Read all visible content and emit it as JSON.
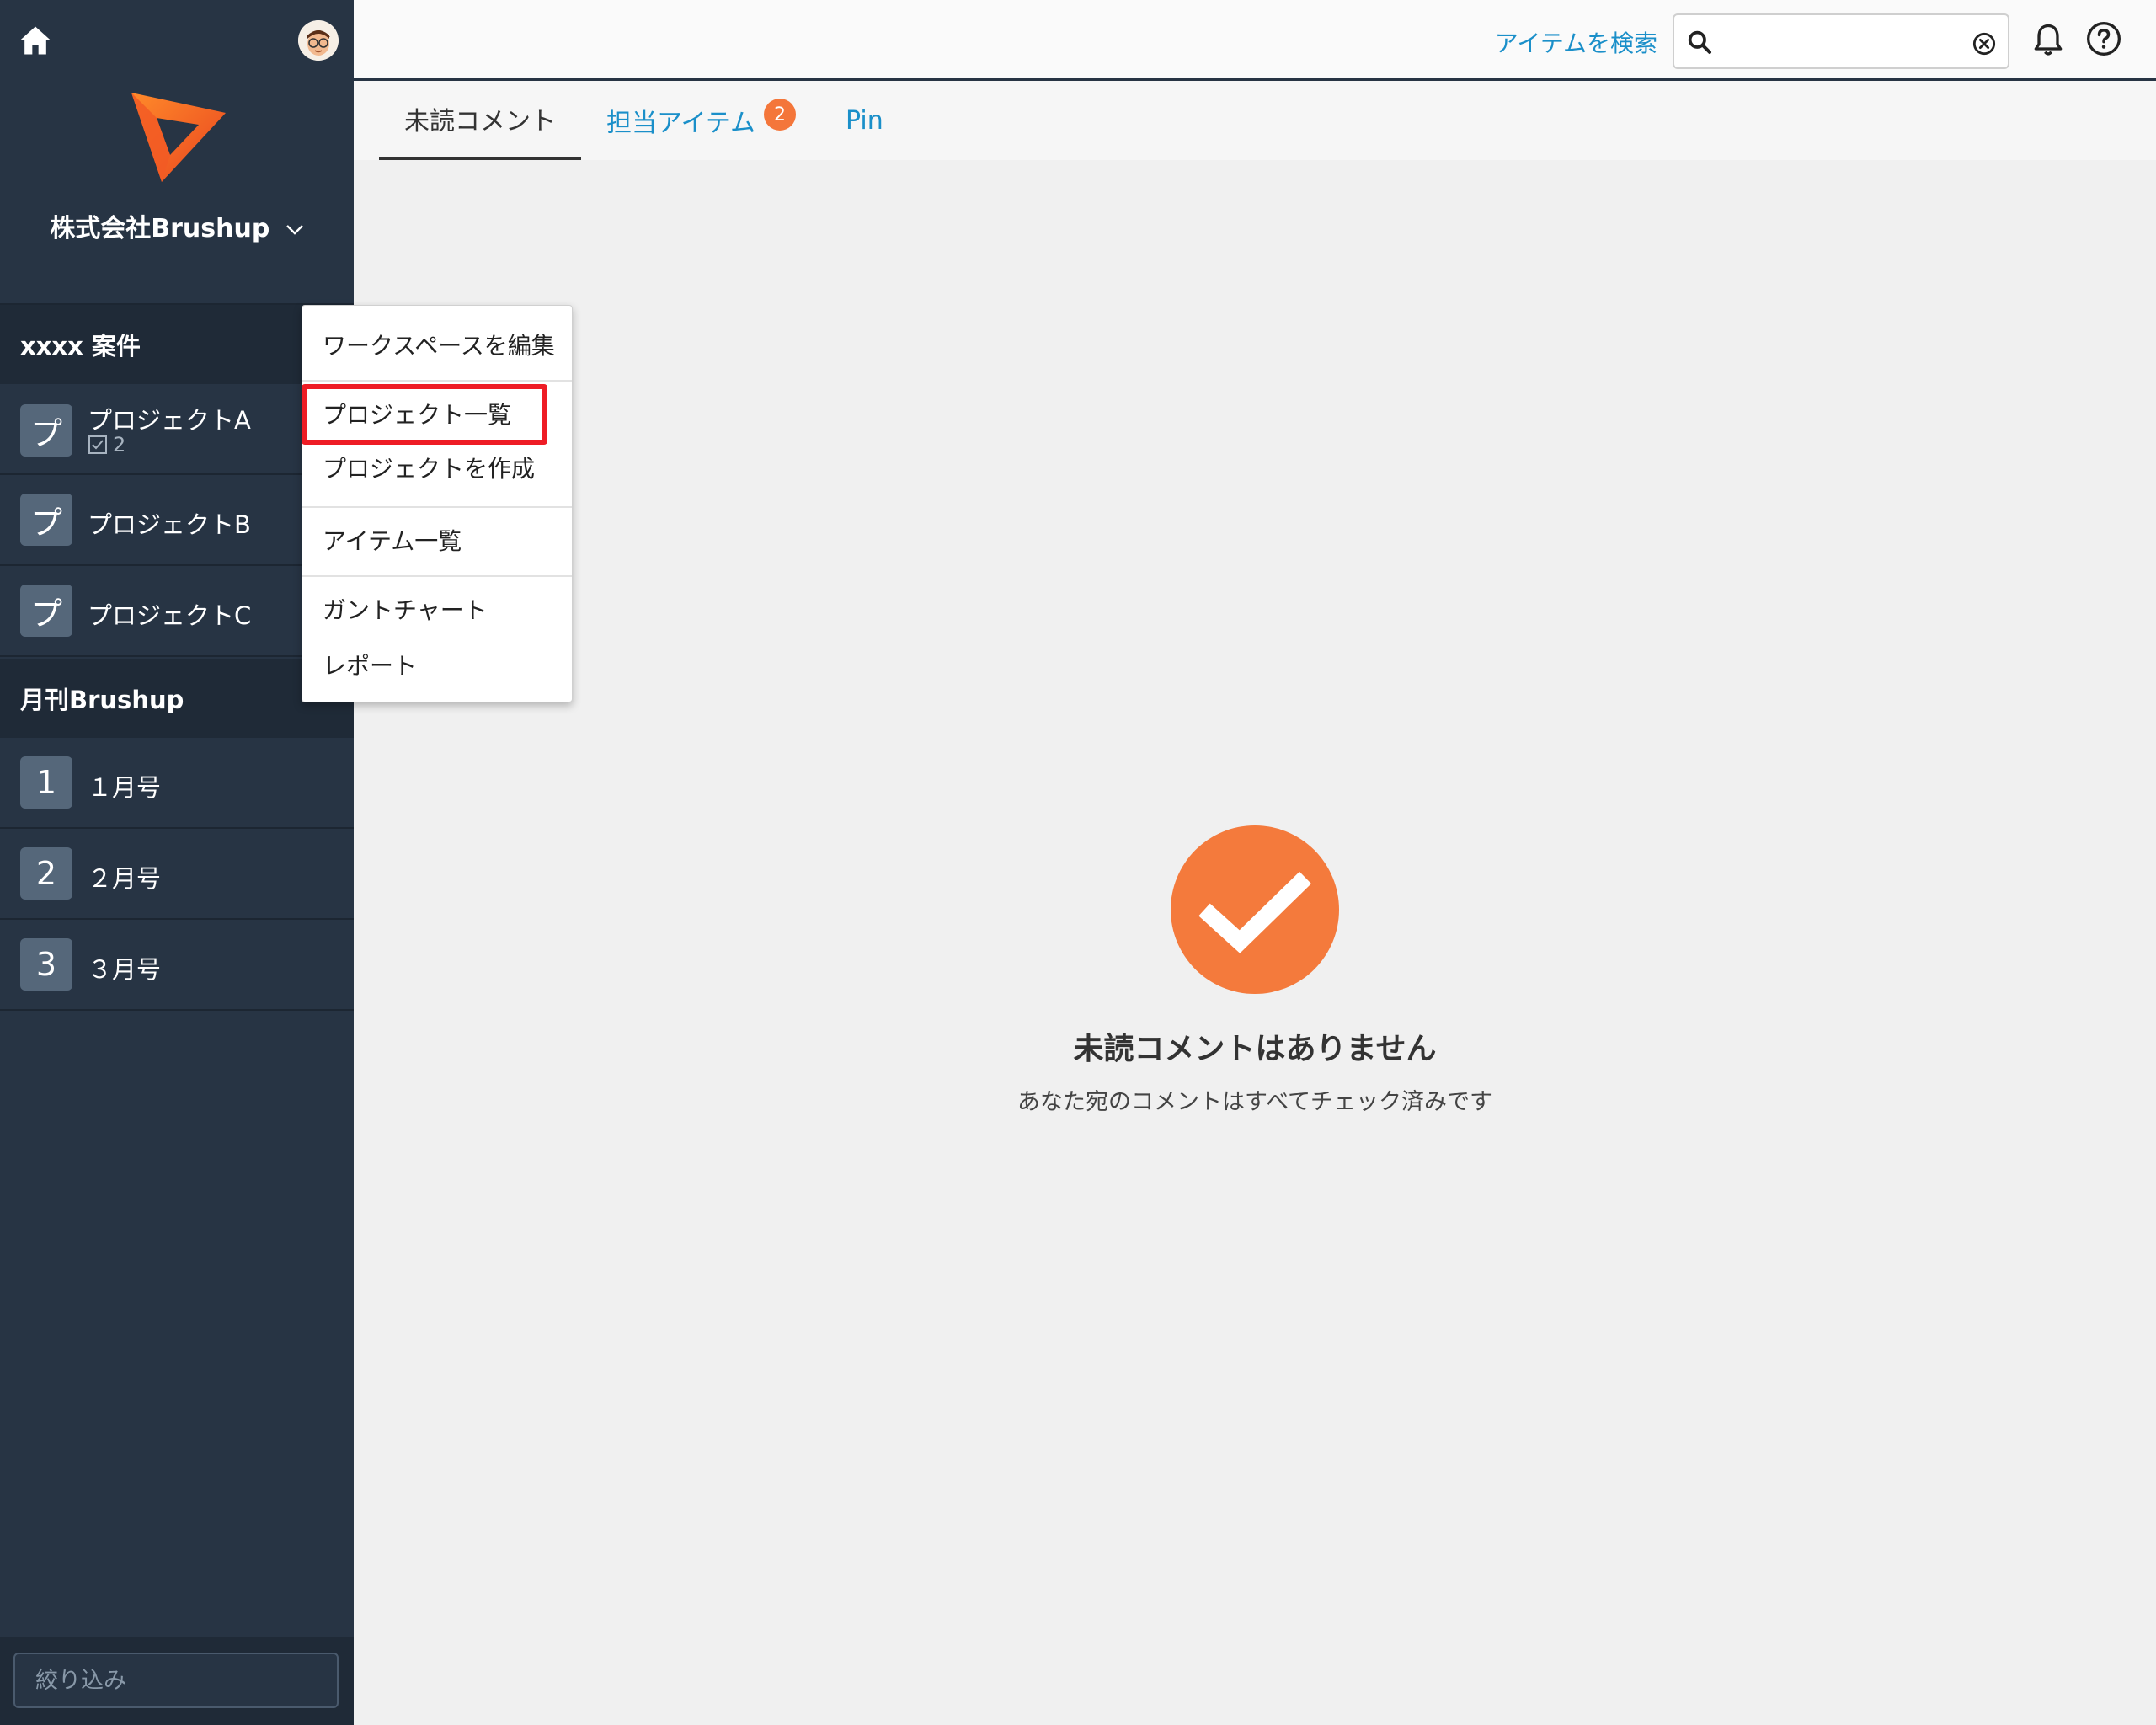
{
  "sidebar": {
    "org_name": "株式会社Brushup",
    "workspaces": [
      {
        "name": "xxxx 案件",
        "projects": [
          {
            "tile": "プ",
            "name": "プロジェクトA",
            "task_count": "2"
          },
          {
            "tile": "プ",
            "name": "プロジェクトB"
          },
          {
            "tile": "プ",
            "name": "プロジェクトC"
          }
        ]
      },
      {
        "name": "月刊Brushup",
        "projects": [
          {
            "tile": "1",
            "name": "１月号"
          },
          {
            "tile": "2",
            "name": "２月号"
          },
          {
            "tile": "3",
            "name": "３月号"
          }
        ]
      }
    ],
    "filter_placeholder": "絞り込み"
  },
  "topbar": {
    "search_link": "アイテムを検索",
    "search_value": ""
  },
  "tabs": [
    {
      "label": "未読コメント",
      "active": true
    },
    {
      "label": "担当アイテム",
      "badge": "2"
    },
    {
      "label": "Pin"
    }
  ],
  "empty_state": {
    "title": "未読コメントはありません",
    "subtitle": "あなた宛のコメントはすべてチェック済みです"
  },
  "menu": {
    "items": [
      "ワークスペースを編集",
      "プロジェクト一覧",
      "プロジェクトを作成",
      "アイテム一覧",
      "ガントチャート",
      "レポート"
    ]
  },
  "colors": {
    "sidebar_bg": "#273444",
    "accent_orange": "#f47a3c",
    "link_blue": "#1a8fc9",
    "highlight_red": "#ee1c25"
  }
}
